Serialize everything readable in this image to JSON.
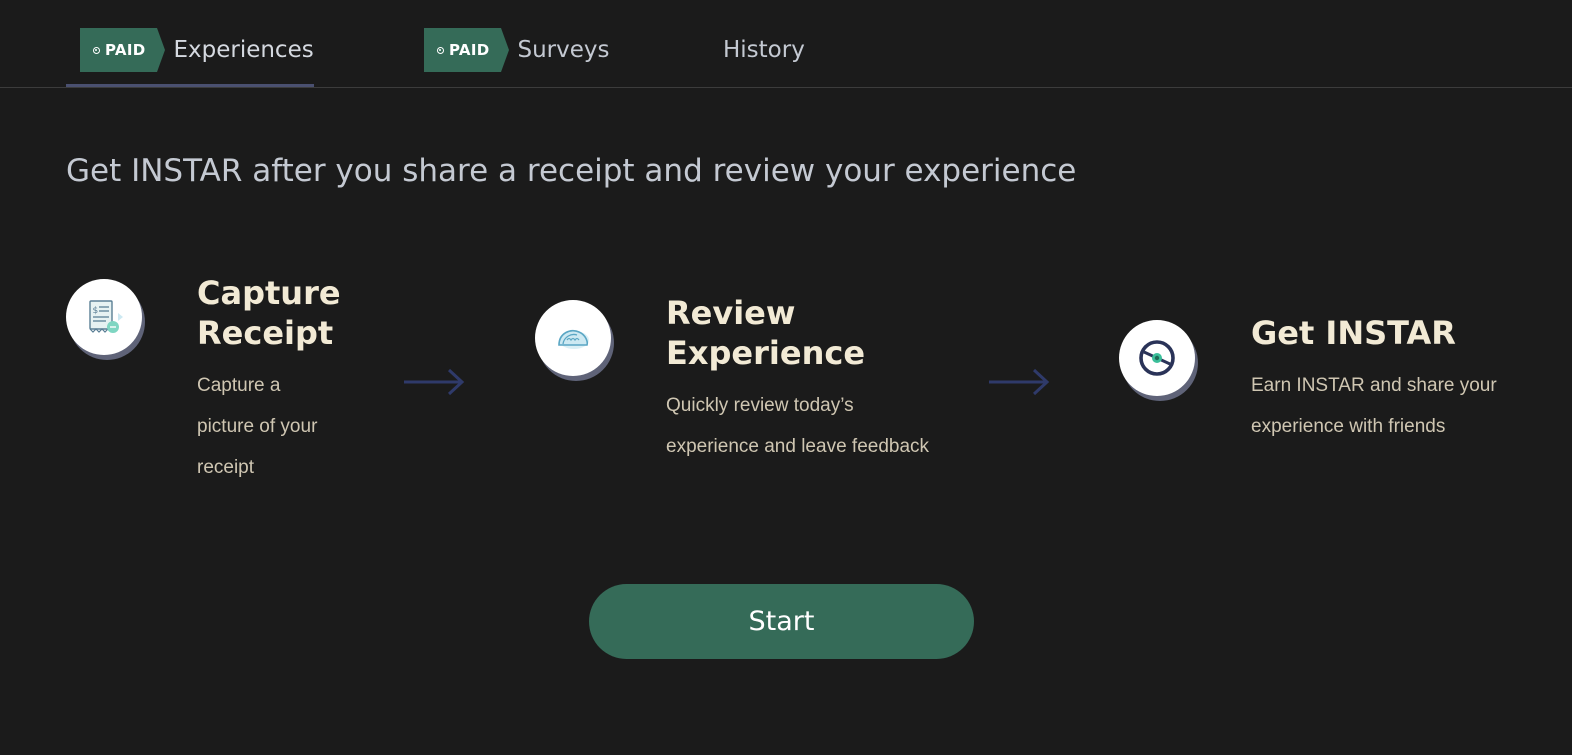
{
  "tabs": [
    {
      "badge": "PAID",
      "label": "Experiences",
      "active": true
    },
    {
      "badge": "PAID",
      "label": "Surveys",
      "active": false
    },
    {
      "label": "History",
      "active": false
    }
  ],
  "headline": "Get INSTAR after you share a receipt and review your experience",
  "steps": [
    {
      "icon": "receipt-icon",
      "title_line1": "Capture",
      "title_line2": "Receipt",
      "desc_line1": "Capture a",
      "desc_line2": "picture of your",
      "desc_line3": "receipt"
    },
    {
      "icon": "taco-icon",
      "title_line1": "Review",
      "title_line2": "Experience",
      "desc_line1": "Quickly review today’s",
      "desc_line2": "experience and leave feedback"
    },
    {
      "icon": "instar-coin-icon",
      "title_line1": "Get INSTAR",
      "desc_line1": "Earn INSTAR and share your",
      "desc_line2": "experience with friends"
    }
  ],
  "start_label": "Start",
  "colors": {
    "background": "#1b1b1b",
    "accent_green": "#356b58",
    "title_cream": "#f2ead5",
    "desc_cream": "#cfc6b2",
    "arrow_navy": "#2f3a6a"
  }
}
